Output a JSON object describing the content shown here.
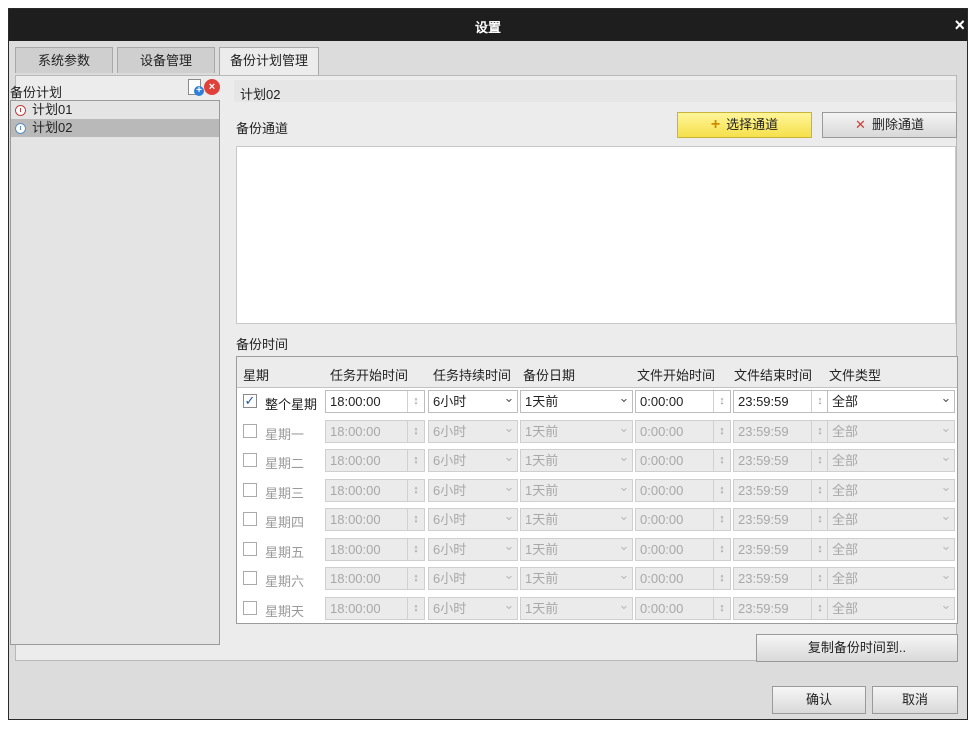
{
  "window": {
    "title": "设置",
    "close_symbol": "×"
  },
  "tabs": [
    {
      "label": "系统参数"
    },
    {
      "label": "设备管理"
    },
    {
      "label": "备份计划管理"
    }
  ],
  "sidebar": {
    "title": "备份计划",
    "plans": [
      {
        "label": "计划01"
      },
      {
        "label": "计划02"
      }
    ]
  },
  "plan": {
    "name": "计划02",
    "channel_label": "备份通道",
    "select_button": "选择通道",
    "delete_button": "删除通道",
    "time_label": "备份时间"
  },
  "table": {
    "headers": [
      "星期",
      "任务开始时间",
      "任务持续时间",
      "备份日期",
      "文件开始时间",
      "文件结束时间",
      "文件类型"
    ],
    "rows": [
      {
        "day": "整个星期",
        "checked": true,
        "start": "18:00:00",
        "duration": "6小时",
        "date": "1天前",
        "file_start": "0:00:00",
        "file_end": "23:59:59",
        "type": "全部"
      },
      {
        "day": "星期一",
        "checked": false,
        "start": "18:00:00",
        "duration": "6小时",
        "date": "1天前",
        "file_start": "0:00:00",
        "file_end": "23:59:59",
        "type": "全部"
      },
      {
        "day": "星期二",
        "checked": false,
        "start": "18:00:00",
        "duration": "6小时",
        "date": "1天前",
        "file_start": "0:00:00",
        "file_end": "23:59:59",
        "type": "全部"
      },
      {
        "day": "星期三",
        "checked": false,
        "start": "18:00:00",
        "duration": "6小时",
        "date": "1天前",
        "file_start": "0:00:00",
        "file_end": "23:59:59",
        "type": "全部"
      },
      {
        "day": "星期四",
        "checked": false,
        "start": "18:00:00",
        "duration": "6小时",
        "date": "1天前",
        "file_start": "0:00:00",
        "file_end": "23:59:59",
        "type": "全部"
      },
      {
        "day": "星期五",
        "checked": false,
        "start": "18:00:00",
        "duration": "6小时",
        "date": "1天前",
        "file_start": "0:00:00",
        "file_end": "23:59:59",
        "type": "全部"
      },
      {
        "day": "星期六",
        "checked": false,
        "start": "18:00:00",
        "duration": "6小时",
        "date": "1天前",
        "file_start": "0:00:00",
        "file_end": "23:59:59",
        "type": "全部"
      },
      {
        "day": "星期天",
        "checked": false,
        "start": "18:00:00",
        "duration": "6小时",
        "date": "1天前",
        "file_start": "0:00:00",
        "file_end": "23:59:59",
        "type": "全部"
      }
    ]
  },
  "buttons": {
    "copy": "复制备份时间到..",
    "ok": "确认",
    "cancel": "取消"
  },
  "colors": {
    "titlebar": "#1e1e1e",
    "select_button": "#f5e04a",
    "delete_icon": "#d93a30",
    "check": "#1a56b8"
  }
}
